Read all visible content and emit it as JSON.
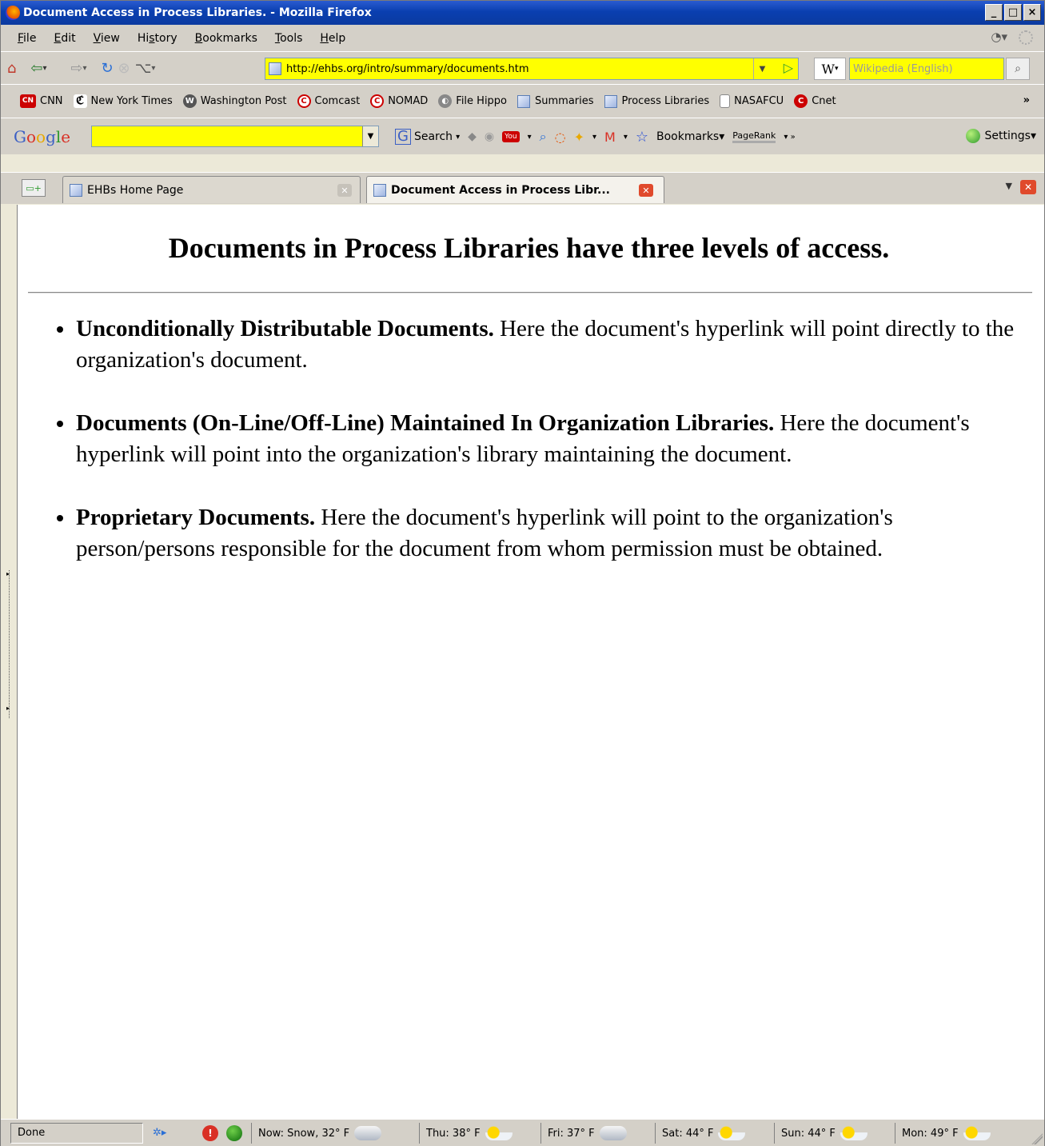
{
  "window": {
    "title": "Document Access in Process Libraries. - Mozilla Firefox",
    "min": "_",
    "max": "□",
    "close": "×"
  },
  "menu": [
    "File",
    "Edit",
    "View",
    "History",
    "Bookmarks",
    "Tools",
    "Help"
  ],
  "menu_access_keys": [
    "F",
    "E",
    "V",
    "s",
    "B",
    "T",
    "H"
  ],
  "navigation": {
    "url": "http://ehbs.org/intro/summary/documents.htm",
    "search_engine_label": "W",
    "search_placeholder": "Wikipedia (English)"
  },
  "bookmarks": [
    {
      "label": "CNN",
      "icon": "cnn-icon"
    },
    {
      "label": "New York Times",
      "icon": "nyt-icon"
    },
    {
      "label": "Washington Post",
      "icon": "wapo-icon"
    },
    {
      "label": "Comcast",
      "icon": "comcast-icon"
    },
    {
      "label": "NOMAD",
      "icon": "nomad-icon"
    },
    {
      "label": "File Hippo",
      "icon": "filehippo-icon"
    },
    {
      "label": "Summaries",
      "icon": "page-icon"
    },
    {
      "label": "Process Libraries",
      "icon": "page-icon"
    },
    {
      "label": "NASAFCU",
      "icon": "blank-page-icon"
    },
    {
      "label": "Cnet",
      "icon": "cnet-icon"
    }
  ],
  "bookmarks_overflow": "»",
  "google_toolbar": {
    "logo": "Google",
    "search_label": "Search",
    "bookmarks_label": "Bookmarks",
    "pagerank_label": "PageRank",
    "settings_label": "Settings"
  },
  "tabs": [
    {
      "label": "EHBs Home Page",
      "active": false
    },
    {
      "label": "Document Access in Process Libr...",
      "active": true
    }
  ],
  "page": {
    "heading": "Documents in Process Libraries have three levels of access.",
    "items": [
      {
        "bold": "Unconditionally Distributable Documents.",
        "text": " Here the document's hyperlink will point directly to the organization's document."
      },
      {
        "bold": "Documents (On-Line/Off-Line) Maintained In Organization Libraries.",
        "text": " Here the document's hyperlink will point into the organization's library maintaining the document."
      },
      {
        "bold": "Proprietary Documents.",
        "text": " Here the document's hyperlink will point to the organization's person/persons responsible for the document from whom permission must be obtained."
      }
    ]
  },
  "status": {
    "text": "Done",
    "weather": [
      {
        "label": "Now: Snow, 32° F",
        "icon": "snow-cloud-icon"
      },
      {
        "label": "Thu: 38° F",
        "icon": "partly-sunny-icon"
      },
      {
        "label": "Fri: 37° F",
        "icon": "rain-cloud-icon"
      },
      {
        "label": "Sat: 44° F",
        "icon": "partly-sunny-icon"
      },
      {
        "label": "Sun: 44° F",
        "icon": "partly-sunny-icon"
      },
      {
        "label": "Mon: 49° F",
        "icon": "partly-sunny-icon"
      }
    ]
  }
}
